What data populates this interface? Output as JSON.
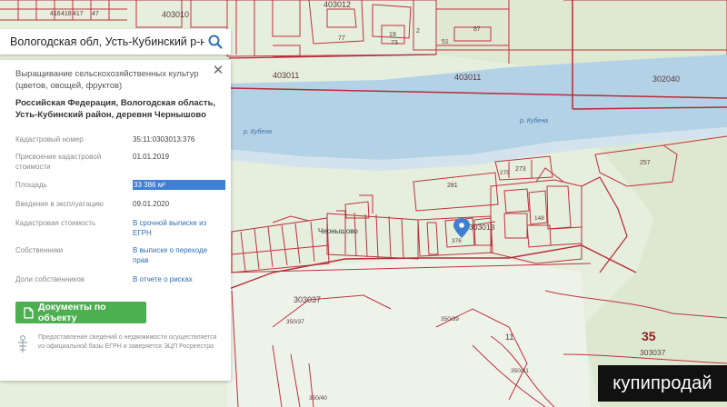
{
  "search": {
    "value": "Вологодская обл, Усть-Кубинский р-н, деревн"
  },
  "card": {
    "close": "✕",
    "purpose": "Выращивание сельскохозяйственных культур (цветов, овощей, фруктов)",
    "address": "Российская Федерация, Вологодская область, Усть-Кубинский район, деревня Чернышово",
    "rows": [
      {
        "label": "Кадастровый номер",
        "value": "35:11:0303013:376"
      },
      {
        "label": "Присвоение кадастровой стоимости",
        "value": "01.01.2019"
      },
      {
        "label": "Площадь",
        "value": "33 386 м²"
      },
      {
        "label": "Введение в эксплуатацию",
        "value": "09.01.2020"
      },
      {
        "label": "Кадастровая стоимость",
        "value": "В срочной выписке из ЕГРН"
      },
      {
        "label": "Собственники",
        "value": "В выписке о переходе прав"
      },
      {
        "label": "Доли собственников",
        "value": "В отчете о рисках"
      }
    ],
    "docs_button": "Документы по объекту",
    "disclaimer": "Предоставление сведений о недвижимости осуществляется из официальной базы ЕГРН и заверяется ЭЦП Росреестра"
  },
  "map": {
    "labels": {
      "l403010": "403010",
      "l403012": "403012",
      "l403011": "403011",
      "l302040": "302040",
      "l403011b": "403011",
      "l416": "416",
      "l418": "418",
      "l417": "417",
      "l47": "47",
      "l87": "87",
      "l77": "77",
      "l19": "19",
      "l73": "73",
      "l2": "2",
      "l51": "51",
      "river1": "р. Кубена",
      "river2": "р. Кубена",
      "l257": "257",
      "l273": "273",
      "l275": "275",
      "l281": "281",
      "l303013": "303013",
      "l376": "376",
      "l148": "148",
      "l303037": "303037",
      "l350_39": "350/39",
      "l350_40": "350/40",
      "l350_41": "350/41",
      "l350_37": "350/37",
      "l35": "35",
      "l303037b": "303037",
      "l11": "11",
      "village": "Чернышово"
    }
  },
  "watermark": "купипродай"
}
